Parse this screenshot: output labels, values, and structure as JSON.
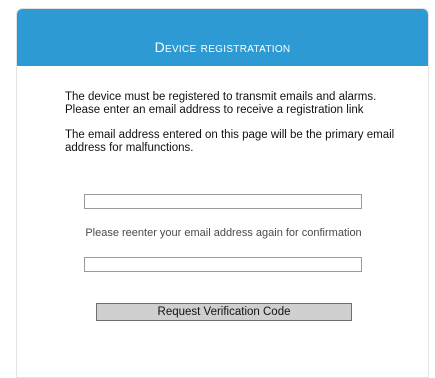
{
  "header": {
    "title": "Device registratation"
  },
  "intro": {
    "paragraph_1": "The device must be registered to transmit emails and alarms. Please enter an email address to receive a registration link",
    "paragraph_2": "The email address entered on this page will be the primary email address for malfunctions."
  },
  "form": {
    "email_value": "",
    "email_placeholder": "",
    "confirm_label": "Please reenter your email address again for confirmation",
    "confirm_value": "",
    "confirm_placeholder": "",
    "submit_label": "Request Verification Code"
  },
  "colors": {
    "header_background": "#2d9ad3",
    "header_text": "#ffffff",
    "button_background": "#cfcfcf"
  }
}
